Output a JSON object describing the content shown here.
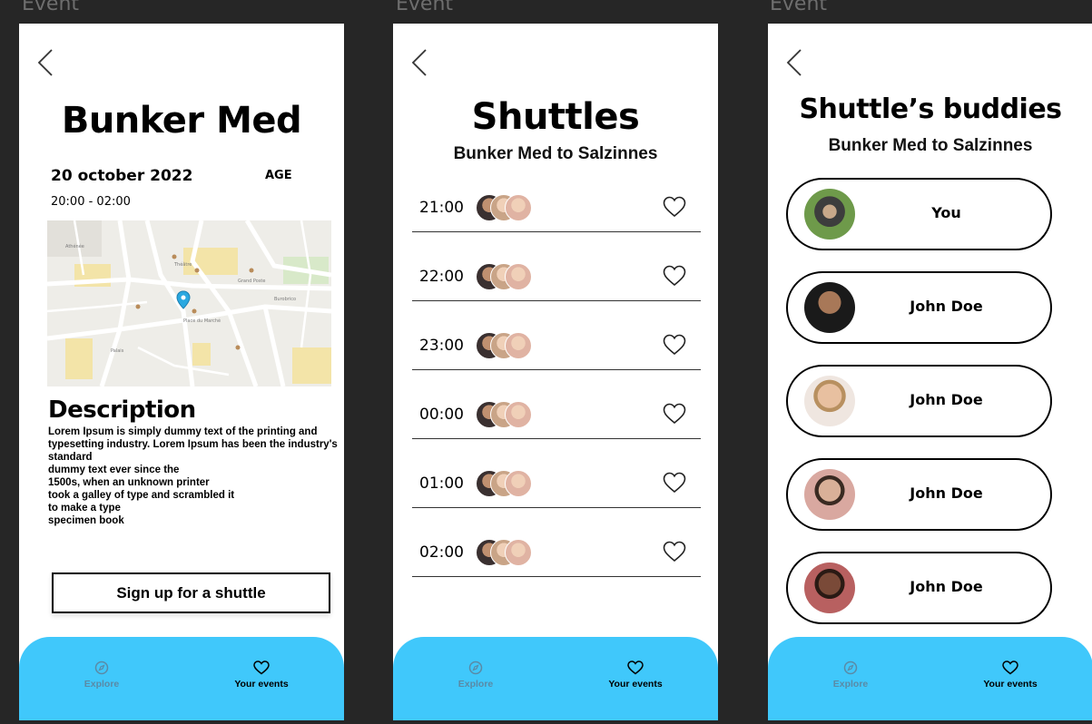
{
  "frame_label": "Event",
  "screen1": {
    "title": "Bunker Med",
    "date": "20 october 2022",
    "age": "AGE",
    "time": "20:00 - 02:00",
    "description_title": "Description",
    "description_text": "Lorem Ipsum is simply dummy text of the printing and typesetting industry. Lorem Ipsum has been the industry's standard\ndummy text ever since the\n1500s, when an unknown printer\ntook a galley of type and scrambled it\nto make a type\nspecimen book",
    "signup_label": "Sign up for a shuttle"
  },
  "screen2": {
    "title": "Shuttles",
    "subtitle": "Bunker Med to Salzinnes",
    "shuttles": [
      {
        "time": "21:00"
      },
      {
        "time": "22:00"
      },
      {
        "time": "23:00"
      },
      {
        "time": "00:00"
      },
      {
        "time": "01:00"
      },
      {
        "time": "02:00"
      }
    ]
  },
  "screen3": {
    "title": "Shuttle’s buddies",
    "subtitle": "Bunker Med to Salzinnes",
    "buddies": [
      {
        "name": "You"
      },
      {
        "name": "John Doe"
      },
      {
        "name": "John Doe"
      },
      {
        "name": "John Doe"
      },
      {
        "name": "John Doe"
      }
    ]
  },
  "nav": {
    "explore_label": "Explore",
    "events_label": "Your events",
    "explore_icon": "compass-icon",
    "events_icon": "heart-icon"
  },
  "colors": {
    "nav_bg": "#40c8fb",
    "background": "#262626",
    "screen_bg": "#ffffff"
  }
}
